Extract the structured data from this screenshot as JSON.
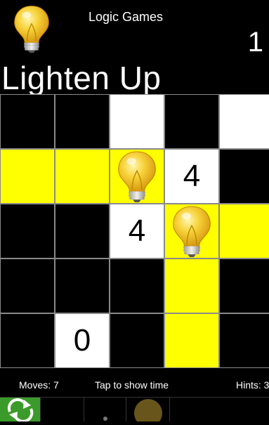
{
  "header": {
    "app_title": "Logic Games",
    "level": "1",
    "game_title": "Lighten Up"
  },
  "board": {
    "rows": 5,
    "cols": 5,
    "cells": [
      [
        "black",
        "black",
        "white",
        "black",
        "white"
      ],
      [
        "yellow",
        "yellow",
        "bulb",
        "4",
        "black"
      ],
      [
        "black",
        "black",
        "4",
        "bulb",
        "yellow"
      ],
      [
        "black",
        "black",
        "black",
        "yellow",
        "black"
      ],
      [
        "black",
        "0",
        "black",
        "yellow",
        "black"
      ]
    ],
    "lit_color": "#ffff00",
    "wall_color": "#000000",
    "empty_color": "#ffffff"
  },
  "status": {
    "moves": "Moves: 7",
    "tap": "Tap to show time",
    "hints": "Hints: 3"
  },
  "toolbar": {
    "items": [
      "restart-icon",
      "blank",
      "dot-icon",
      "lightbulb-icon",
      "blank"
    ]
  }
}
